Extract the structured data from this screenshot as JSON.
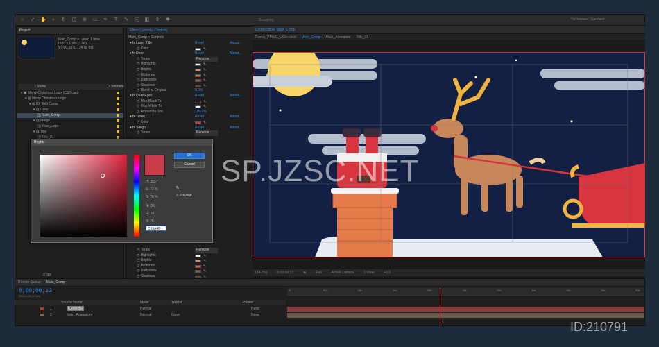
{
  "toolbar": {
    "snapping": "Snapping",
    "workspace": "Workspace: Standard"
  },
  "project": {
    "tab": "Project",
    "comp_name": "Main_Comp ▾ , used 1 time",
    "comp_size": "1920 x 1080 (1.00)",
    "comp_duration": "Δ 0;00;20;01, 24.00 fps",
    "col_name": "Name",
    "col_comment": "Comment",
    "items": [
      "Merry Christmas Logo (CS6).aep",
      "Merry Christmas Logo",
      "01_Edit Comp",
      "Color",
      "Main_Comp",
      "Image",
      "Your_Logo",
      "Title",
      "Title_01"
    ],
    "bpc": "8 bpc"
  },
  "effects": {
    "tab": "Effect Controls: Controls",
    "subtitle": "Main_Comp » Controls",
    "reset": "Reset",
    "about": "About...",
    "rows": [
      {
        "name": "Lase_Title",
        "type": "fx"
      },
      {
        "name": "Color",
        "type": "color",
        "color": "#ffffff"
      },
      {
        "name": "Deer",
        "type": "fx"
      },
      {
        "name": "Tones",
        "type": "value",
        "value": "Pentone"
      },
      {
        "name": "Highlights",
        "type": "color",
        "color": "#f2f2f2"
      },
      {
        "name": "Brights",
        "type": "color",
        "color": "#e08a5a"
      },
      {
        "name": "Midtones",
        "type": "color",
        "color": "#d07040"
      },
      {
        "name": "Darktones",
        "type": "color",
        "color": "#a05a3a"
      },
      {
        "name": "Shadows",
        "type": "color",
        "color": "#7a3a28"
      },
      {
        "name": "Blend w. Original",
        "type": "value",
        "value": "0.0%"
      },
      {
        "name": "Deer Eyes",
        "type": "fx"
      },
      {
        "name": "Map Black To",
        "type": "color",
        "color": "#222222"
      },
      {
        "name": "Map White To",
        "type": "color",
        "color": "#eeeeee"
      },
      {
        "name": "Amount to Tint",
        "type": "value",
        "value": "100.0%"
      },
      {
        "name": "Troue",
        "type": "fx"
      },
      {
        "name": "Color",
        "type": "color",
        "color": "#c93a4b"
      },
      {
        "name": "Sleigh",
        "type": "fx"
      },
      {
        "name": "Tones",
        "type": "value",
        "value": "Pentone"
      }
    ],
    "lower_rows": [
      {
        "name": "Tones",
        "type": "value",
        "value": "Pentone"
      },
      {
        "name": "Highlights",
        "type": "color",
        "color": "#f2f2f2"
      },
      {
        "name": "Brights",
        "type": "color",
        "color": "#e08a5a"
      },
      {
        "name": "Midtones",
        "type": "color",
        "color": "#d07040"
      },
      {
        "name": "Darktones",
        "type": "color",
        "color": "#a05a3a"
      },
      {
        "name": "Shadows",
        "type": "color",
        "color": "#7a3a28"
      }
    ]
  },
  "composition": {
    "tabs": [
      "Footer_PMMC_UChecked",
      "Main_Comp",
      "Main_Animation",
      "Title_01"
    ],
    "tab_label": "Composition: Main_Comp",
    "zoom": "(34.7%)",
    "timecode": "0;00;00;13",
    "quality": "Full",
    "camera": "Active Camera",
    "view": "1 View",
    "offset": "+0.0"
  },
  "color_picker": {
    "title": "Brights",
    "ok": "OK",
    "cancel": "Cancel",
    "preview": "Preview",
    "fields": [
      {
        "label": "H:",
        "value": "355"
      },
      {
        "label": "S:",
        "value": "72"
      },
      {
        "label": "B:",
        "value": "78"
      },
      {
        "label": "R:",
        "value": "201"
      },
      {
        "label": "G:",
        "value": "58"
      },
      {
        "label": "B:",
        "value": "75"
      }
    ],
    "hex": "C93A4B"
  },
  "timeline": {
    "tabs": [
      "Render Queue",
      "Main_Comp"
    ],
    "timecode": "0;00;00;13",
    "fps": "00013 (24.00 fps)",
    "col_source": "Source Name",
    "col_mode": "Mode",
    "col_trkmat": "TrkMat",
    "col_parent": "Parent",
    "layers": [
      {
        "num": "1",
        "name": "[Controls]",
        "mode": "Normal",
        "parent": "None",
        "color": "#c0392b"
      },
      {
        "num": "2",
        "name": "Main_Animation",
        "mode": "Normal",
        "trkmat": "None",
        "parent": "None",
        "color": "#7b6a55"
      }
    ],
    "ticks": [
      "0f",
      "02s",
      "04s",
      "06s",
      "08s",
      "10s",
      "12s",
      "14s",
      "16s",
      "18s",
      "20s"
    ]
  },
  "watermark": "SP.JZSC.NET",
  "watermark_id": "ID:210791"
}
